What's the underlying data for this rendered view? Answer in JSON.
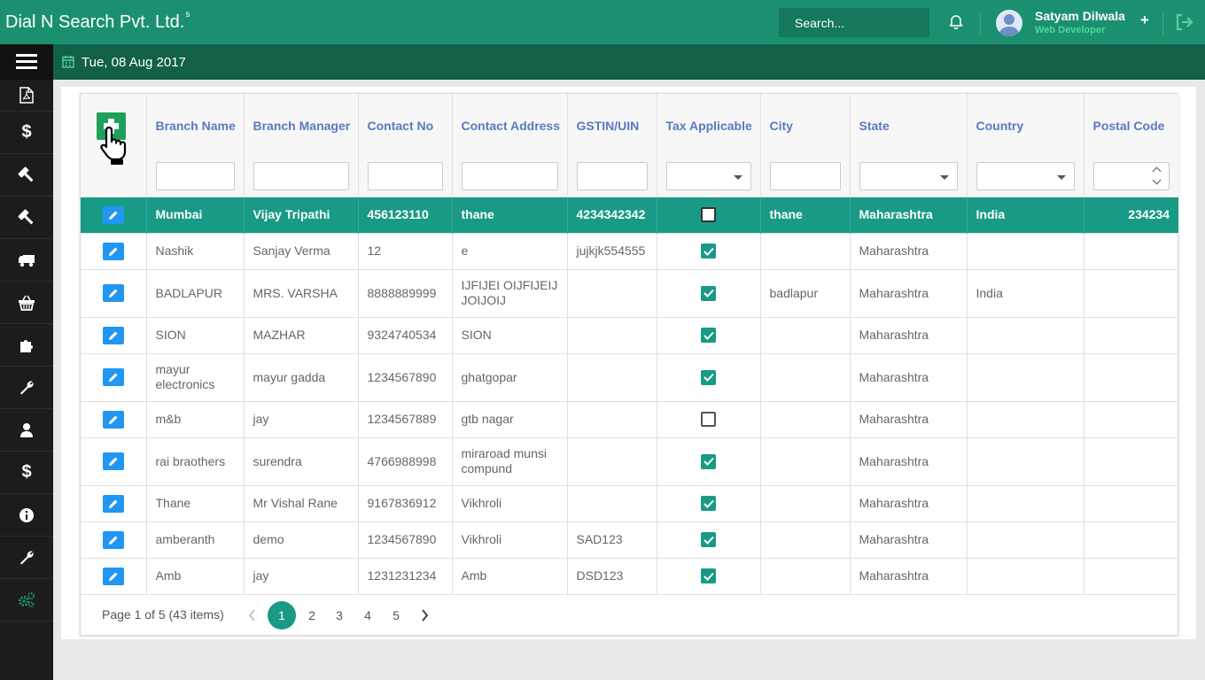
{
  "header": {
    "brand": "Dial N Search Pvt. Ltd.",
    "brand_sup": "s",
    "search_placeholder": "Search...",
    "user_name": "Satyam Dilwala",
    "user_role": "Web Developer",
    "plus": "+"
  },
  "subbar": {
    "date": "Tue, 08 Aug 2017"
  },
  "sidebar": {
    "items": [
      {
        "icon": "pdf-icon"
      },
      {
        "icon": "dollar-icon",
        "glyph": "$"
      },
      {
        "icon": "gavel-icon"
      },
      {
        "icon": "gavel-icon"
      },
      {
        "icon": "truck-icon"
      },
      {
        "icon": "basket-icon"
      },
      {
        "icon": "puzzle-icon"
      },
      {
        "icon": "wrench-icon"
      },
      {
        "icon": "user-icon"
      },
      {
        "icon": "dollar-icon",
        "glyph": "$"
      },
      {
        "icon": "info-icon"
      },
      {
        "icon": "wrench-icon"
      },
      {
        "icon": "gears-icon"
      }
    ]
  },
  "table": {
    "columns": [
      "Branch Name",
      "Branch Manager",
      "Contact No",
      "Contact Address",
      "GSTIN/UIN",
      "Tax Applicable",
      "City",
      "State",
      "Country",
      "Postal Code"
    ],
    "rows": [
      {
        "branch": "Mumbai",
        "manager": "Vijay Tripathi",
        "contact": "456123110",
        "address": "thane",
        "gstin": "4234342342",
        "tax": false,
        "city": "thane",
        "state": "Maharashtra",
        "country": "India",
        "postal": "234234",
        "selected": true
      },
      {
        "branch": "Nashik",
        "manager": "Sanjay Verma",
        "contact": "12",
        "address": "e",
        "gstin": "jujkjk554555",
        "tax": true,
        "city": "",
        "state": "Maharashtra",
        "country": "",
        "postal": ""
      },
      {
        "branch": "BADLAPUR",
        "manager": "MRS. VARSHA",
        "contact": "8888889999",
        "address": "IJFIJEI OIJFIJEIJ JOIJOIJ",
        "gstin": "",
        "tax": true,
        "city": "badlapur",
        "state": "Maharashtra",
        "country": "India",
        "postal": ""
      },
      {
        "branch": "SION",
        "manager": "MAZHAR",
        "contact": "9324740534",
        "address": "SION",
        "gstin": "",
        "tax": true,
        "city": "",
        "state": "Maharashtra",
        "country": "",
        "postal": ""
      },
      {
        "branch": "mayur electronics",
        "manager": "mayur gadda",
        "contact": "1234567890",
        "address": "ghatgopar",
        "gstin": "",
        "tax": true,
        "city": "",
        "state": "Maharashtra",
        "country": "",
        "postal": ""
      },
      {
        "branch": "m&b",
        "manager": "jay",
        "contact": "1234567889",
        "address": "gtb nagar",
        "gstin": "",
        "tax": false,
        "city": "",
        "state": "Maharashtra",
        "country": "",
        "postal": ""
      },
      {
        "branch": "rai braothers",
        "manager": "surendra",
        "contact": "4766988998",
        "address": "miraroad munsi compund",
        "gstin": "",
        "tax": true,
        "city": "",
        "state": "Maharashtra",
        "country": "",
        "postal": ""
      },
      {
        "branch": "Thane",
        "manager": "Mr Vishal Rane",
        "contact": "9167836912",
        "address": "Vikhroli",
        "gstin": "",
        "tax": true,
        "city": "",
        "state": "Maharashtra",
        "country": "",
        "postal": ""
      },
      {
        "branch": "amberanth",
        "manager": "demo",
        "contact": "1234567890",
        "address": "Vikhroli",
        "gstin": "SAD123",
        "tax": true,
        "city": "",
        "state": "Maharashtra",
        "country": "",
        "postal": ""
      },
      {
        "branch": "Amb",
        "manager": "jay",
        "contact": "1231231234",
        "address": "Amb",
        "gstin": "DSD123",
        "tax": true,
        "city": "",
        "state": "Maharashtra",
        "country": "",
        "postal": ""
      }
    ]
  },
  "pager": {
    "info": "Page 1 of 5 (43 items)",
    "pages": [
      "1",
      "2",
      "3",
      "4",
      "5"
    ],
    "current": "1"
  },
  "colors": {
    "topbar": "#1b9070",
    "subbar": "#136049",
    "selected_row": "#199a86",
    "header_text": "#5c78c0"
  }
}
